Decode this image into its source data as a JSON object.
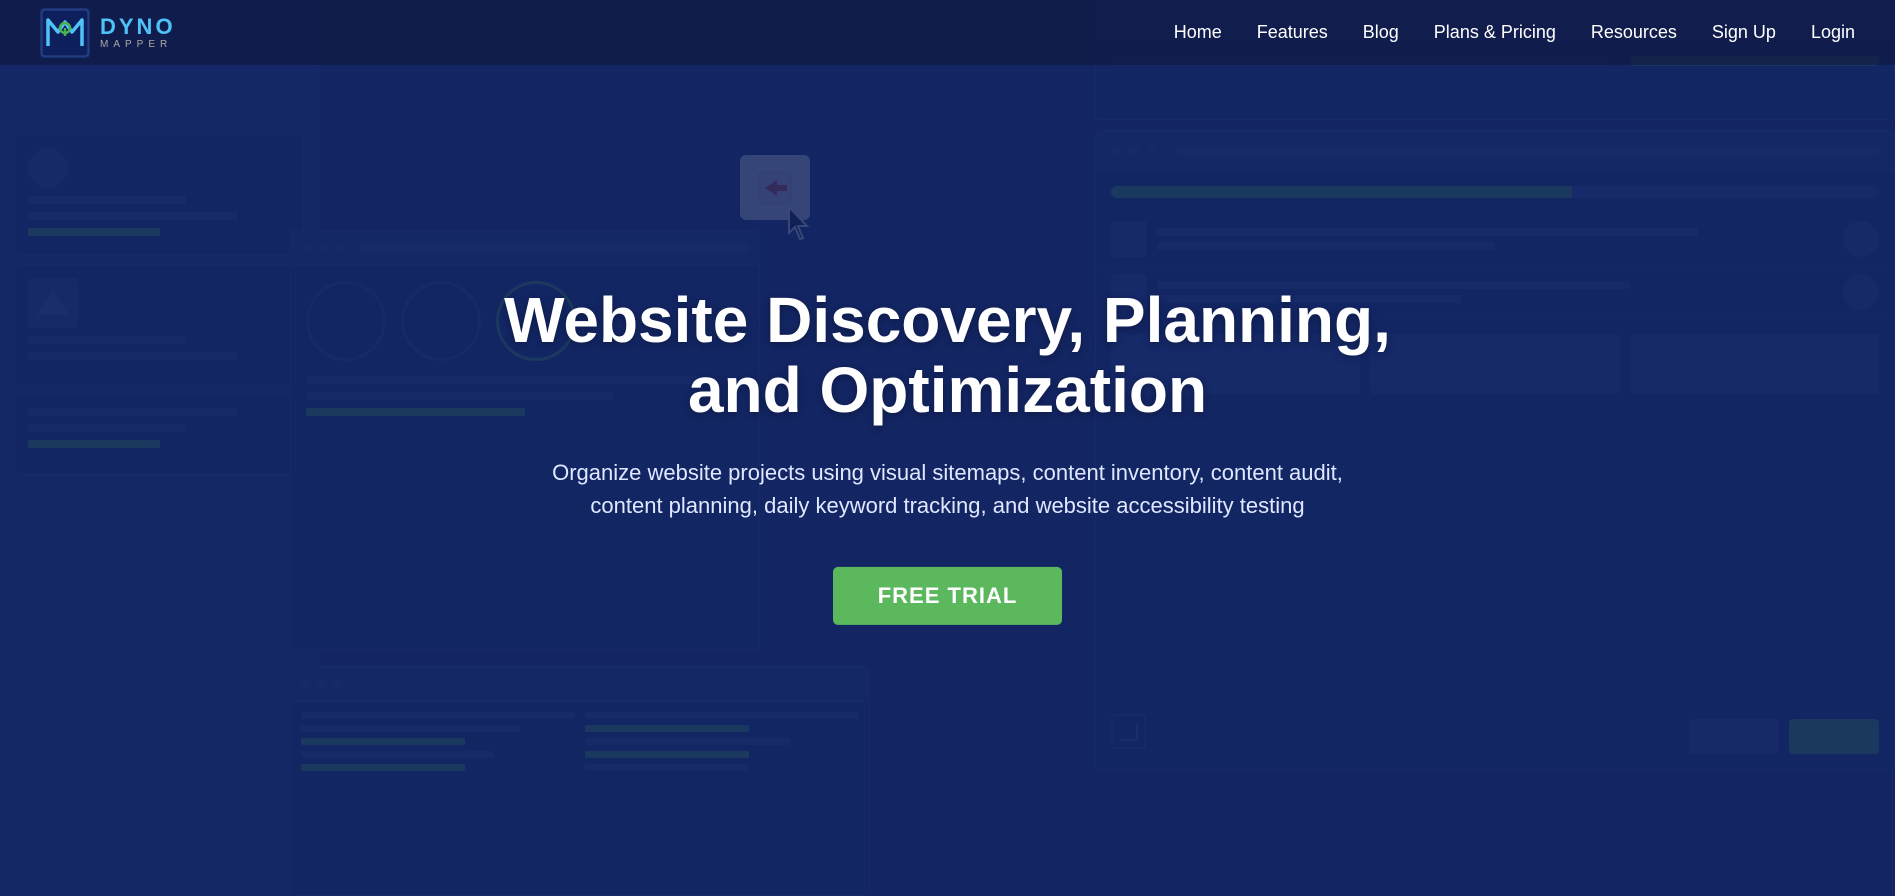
{
  "brand": {
    "name": "Dyno Mapper",
    "logo_alt": "Dyno Mapper Logo"
  },
  "navbar": {
    "links": [
      {
        "label": "Home",
        "id": "home"
      },
      {
        "label": "Features",
        "id": "features"
      },
      {
        "label": "Blog",
        "id": "blog"
      },
      {
        "label": "Plans & Pricing",
        "id": "plans"
      },
      {
        "label": "Resources",
        "id": "resources"
      },
      {
        "label": "Sign Up",
        "id": "signup"
      },
      {
        "label": "Login",
        "id": "login"
      }
    ]
  },
  "hero": {
    "title_line1": "Website Discovery, Planning,",
    "title_line2": "and Optimization",
    "subtitle": "Organize website projects using visual sitemaps, content inventory, content audit,\ncontent planning, daily keyword tracking, and website accessibility testing",
    "cta_label": "FREE TRIAL"
  },
  "colors": {
    "accent_green": "#5cb85c",
    "dark_blue": "#1a2d6b",
    "nav_bg": "#0f1941",
    "text_white": "#ffffff"
  }
}
